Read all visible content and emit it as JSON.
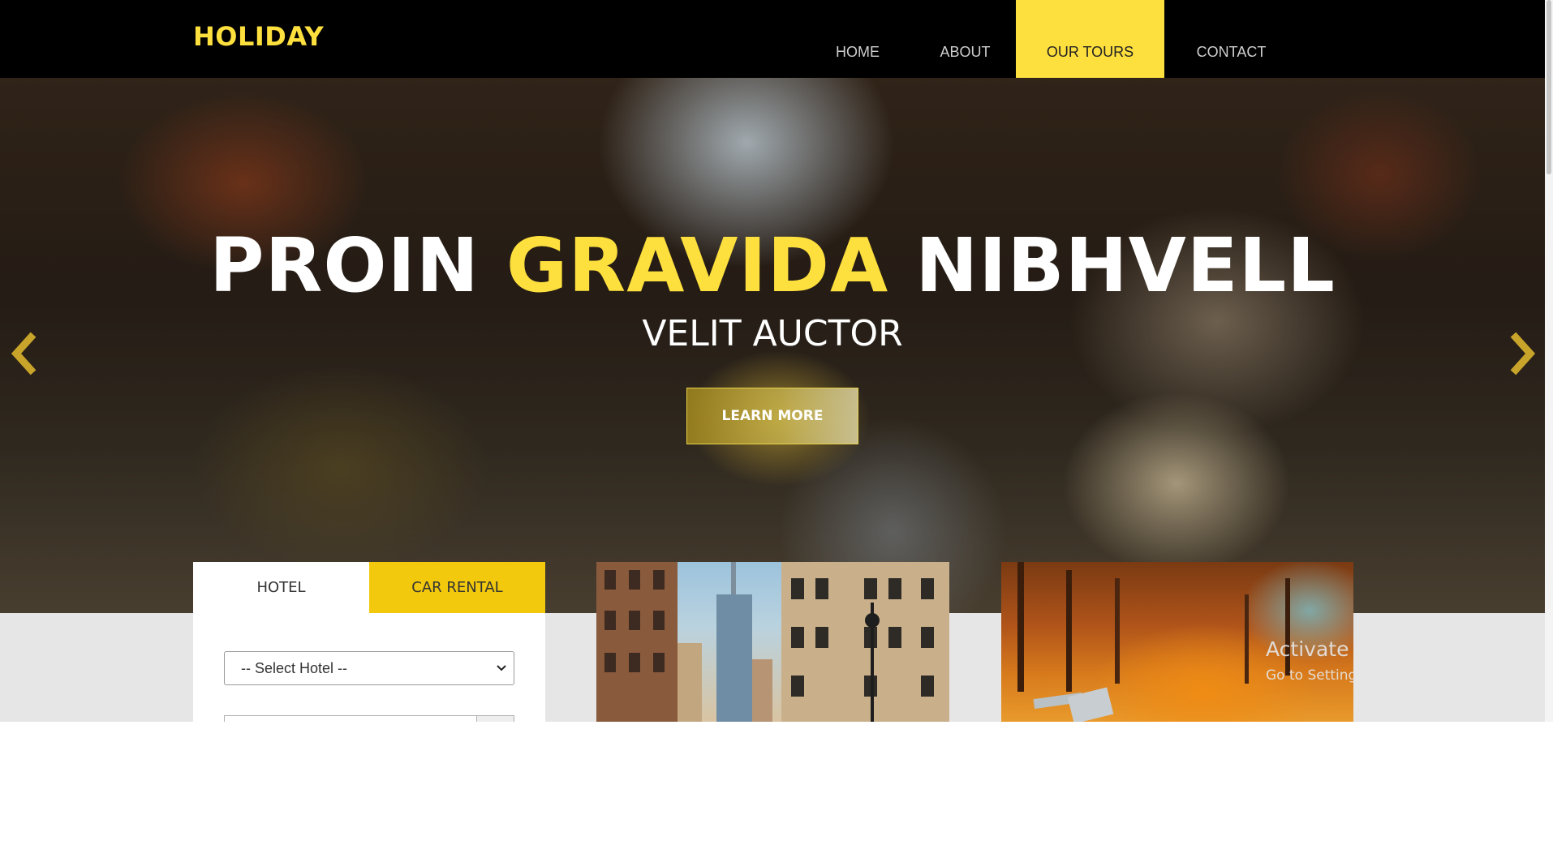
{
  "header": {
    "logo": "HOLIDAY",
    "nav": [
      {
        "label": "HOME",
        "active": false
      },
      {
        "label": "ABOUT",
        "active": false
      },
      {
        "label": "OUR TOURS",
        "active": true
      },
      {
        "label": "CONTACT",
        "active": false
      }
    ]
  },
  "hero": {
    "title_part1": "PROIN ",
    "title_accent": "GRAVIDA",
    "title_part2": " NIBHVELL",
    "subtitle": "VELIT AUCTOR",
    "button_label": "LEARN MORE",
    "prev_icon": "chevron-left-icon",
    "next_icon": "chevron-right-icon"
  },
  "booking": {
    "tabs": [
      {
        "label": "HOTEL",
        "active": true
      },
      {
        "label": "CAR RENTAL",
        "active": false
      }
    ],
    "select_value": "-- Select Hotel --"
  },
  "watermark": {
    "title": "Activate Windows",
    "subtitle": "Go to Settings to activate Windows."
  },
  "colors": {
    "accent": "#fddf3e",
    "tab_accent": "#f2c90c",
    "header_bg": "#000000"
  }
}
